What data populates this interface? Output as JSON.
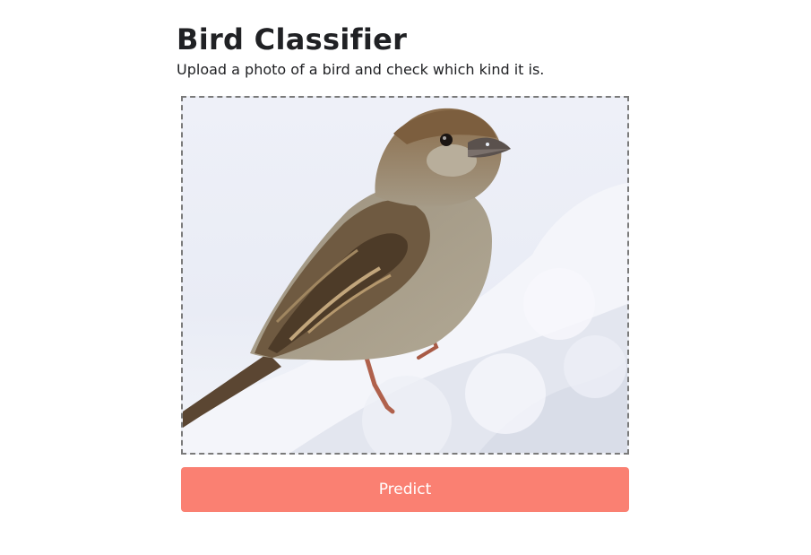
{
  "app": {
    "title": "Bird Classifier",
    "subtitle": "Upload a photo of a bird and check which kind it is."
  },
  "upload": {
    "image_subject": "sparrow on snow"
  },
  "actions": {
    "predict_label": "Predict"
  },
  "colors": {
    "predict_button": "#fa8072",
    "drop_border": "#7a7a7a"
  }
}
